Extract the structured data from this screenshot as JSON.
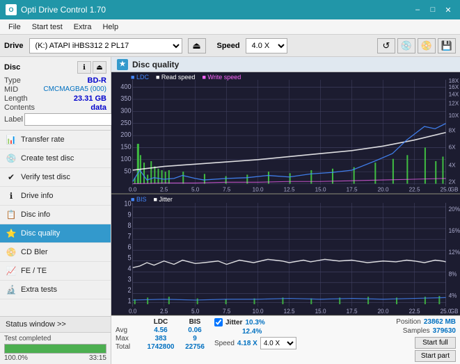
{
  "titleBar": {
    "title": "Opti Drive Control 1.70",
    "minimizeBtn": "–",
    "maximizeBtn": "□",
    "closeBtn": "✕"
  },
  "menuBar": {
    "items": [
      "File",
      "Start test",
      "Extra",
      "Help"
    ]
  },
  "driveBar": {
    "driveLabel": "Drive",
    "driveValue": "(K:) ATAPI iHBS312  2 PL17",
    "speedLabel": "Speed",
    "speedValue": "4.0 X"
  },
  "disc": {
    "title": "Disc",
    "type": {
      "key": "Type",
      "value": "BD-R"
    },
    "mid": {
      "key": "MID",
      "value": "CMCMAGBA5 (000)"
    },
    "length": {
      "key": "Length",
      "value": "23.31 GB"
    },
    "contents": {
      "key": "Contents",
      "value": "data"
    },
    "label": {
      "key": "Label",
      "value": ""
    }
  },
  "nav": {
    "items": [
      {
        "id": "transfer-rate",
        "label": "Transfer rate",
        "icon": "📊"
      },
      {
        "id": "create-test-disc",
        "label": "Create test disc",
        "icon": "💿"
      },
      {
        "id": "verify-test-disc",
        "label": "Verify test disc",
        "icon": "✔"
      },
      {
        "id": "drive-info",
        "label": "Drive info",
        "icon": "ℹ"
      },
      {
        "id": "disc-info",
        "label": "Disc info",
        "icon": "📋"
      },
      {
        "id": "disc-quality",
        "label": "Disc quality",
        "icon": "⭐",
        "active": true
      },
      {
        "id": "cd-bler",
        "label": "CD Bler",
        "icon": "📀"
      },
      {
        "id": "fe-te",
        "label": "FE / TE",
        "icon": "📈"
      },
      {
        "id": "extra-tests",
        "label": "Extra tests",
        "icon": "🔬"
      }
    ],
    "statusWindow": "Status window >>",
    "testComplete": "Test completed"
  },
  "discQuality": {
    "title": "Disc quality",
    "icon": "★",
    "legend": {
      "ldc": "LDC",
      "readSpeed": "Read speed",
      "writeSpeed": "Write speed"
    },
    "yAxisTop": [
      "400",
      "350",
      "300",
      "250",
      "200",
      "150",
      "100",
      "50"
    ],
    "yAxisRight": [
      "18X",
      "16X",
      "14X",
      "12X",
      "10X",
      "8X",
      "6X",
      "4X",
      "2X"
    ],
    "xAxis": [
      "0.0",
      "2.5",
      "5.0",
      "7.5",
      "10.0",
      "12.5",
      "15.0",
      "17.5",
      "20.0",
      "22.5",
      "25.0"
    ],
    "legend2": {
      "bis": "BIS",
      "jitter": "Jitter"
    },
    "yAxis2Top": [
      "10",
      "9",
      "8",
      "7",
      "6",
      "5",
      "4",
      "3",
      "2",
      "1"
    ],
    "yAxis2Right": [
      "20%",
      "16%",
      "12%",
      "8%",
      "4%"
    ]
  },
  "stats": {
    "headers": [
      "LDC",
      "BIS",
      "",
      "Jitter",
      "Speed",
      "",
      ""
    ],
    "avg": {
      "label": "Avg",
      "ldc": "4.56",
      "bis": "0.06",
      "jitter": "10.3%"
    },
    "max": {
      "label": "Max",
      "ldc": "383",
      "bis": "9",
      "jitter": "12.4%"
    },
    "total": {
      "label": "Total",
      "ldc": "1742800",
      "bis": "22756"
    },
    "speed": {
      "label": "Speed",
      "value": "4.18 X",
      "select": "4.0 X"
    },
    "position": {
      "label": "Position",
      "value": "23862 MB"
    },
    "samples": {
      "label": "Samples",
      "value": "379630"
    },
    "jitterChecked": true,
    "startFull": "Start full",
    "startPart": "Start part"
  },
  "bottom": {
    "statusText": "Test completed",
    "progress": 100,
    "progressText": "100.0%",
    "time": "33:15"
  },
  "colors": {
    "ldc": "#4488ff",
    "readSpeed": "#ffffff",
    "writeSpeed": "#ff44ff",
    "bis": "#4488ff",
    "jitter": "#ffffff",
    "greenBars": "#44cc44",
    "chartBg": "#1a1a2e",
    "gridLine": "#444466",
    "accent": "#3399cc"
  }
}
